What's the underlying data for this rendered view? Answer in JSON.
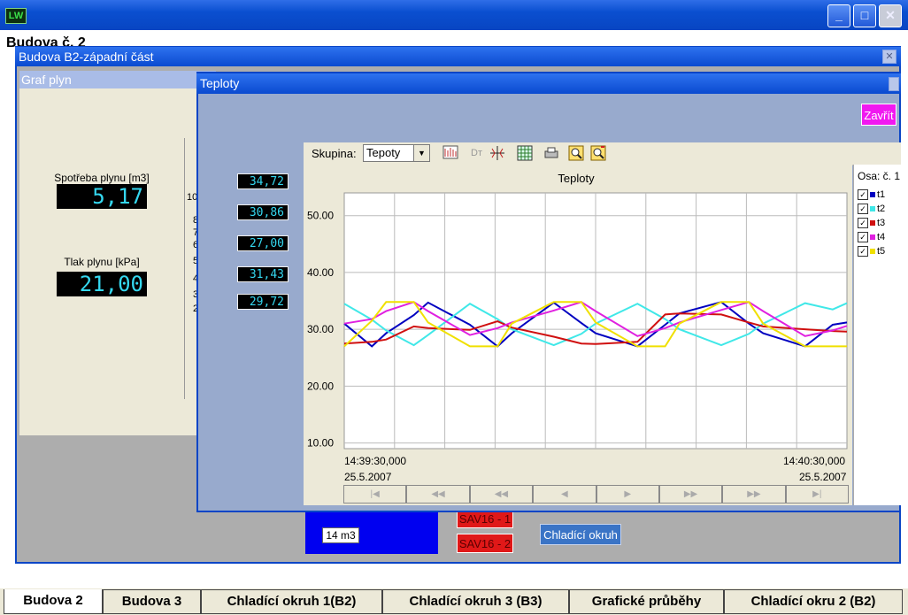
{
  "app": {
    "icon_text": "LW",
    "page_heading": "Budova č. 2",
    "window_buttons": {
      "minimize": "_",
      "maximize": "□",
      "close": "✕"
    }
  },
  "window_b2": {
    "title": "Budova B2-západní část",
    "close": "✕",
    "gas_panel": {
      "title": "Graf plyn",
      "consumption_label": "Spotřeba plynu [m3]",
      "consumption_value": "5,17",
      "pressure_label": "Tlak plynu [kPa]",
      "pressure_value": "21,00",
      "axis_peek": [
        "10",
        "8",
        "7",
        "6",
        "5",
        "4",
        "3",
        "2"
      ]
    },
    "lower": {
      "blue_label": "14 m3",
      "sav_buttons": [
        "SAV16 - 1",
        "SAV16 - 2"
      ],
      "cooling_button": "Chladící okruh"
    }
  },
  "window_teploty": {
    "title": "Teploty",
    "close_button": "Zavřít",
    "readouts": [
      "34,72",
      "30,86",
      "27,00",
      "31,43",
      "29,72"
    ],
    "toolbar": {
      "group_label": "Skupina:",
      "group_value": "Tepoty",
      "icons": [
        "chart-icon",
        "dt-icon",
        "cursor-icon",
        "grid-icon",
        "print-icon",
        "zoom-in-icon",
        "zoom-out-icon"
      ]
    },
    "legend": {
      "title": "Osa: č. 1",
      "items": [
        {
          "label": "t1",
          "color": "#0000c0"
        },
        {
          "label": "t2",
          "color": "#40e8e8"
        },
        {
          "label": "t3",
          "color": "#d01010"
        },
        {
          "label": "t4",
          "color": "#e020e0"
        },
        {
          "label": "t5",
          "color": "#f0e000"
        }
      ]
    },
    "time_axis": {
      "start_time": "14:39:30,000",
      "start_date": "25.5.2007",
      "end_time": "14:40:30,000",
      "end_date": "25.5.2007"
    },
    "nav_buttons": [
      "|◀",
      "◀◀",
      "◀◀",
      "◀",
      "▶",
      "▶▶",
      "▶▶",
      "▶|"
    ]
  },
  "chart_data": {
    "type": "line",
    "title": "Teploty",
    "xlabel": "",
    "ylabel": "",
    "ylim": [
      9,
      54
    ],
    "yticks": [
      "50.00",
      "40.00",
      "30.00",
      "20.00",
      "10.00"
    ],
    "ytick_values": [
      50,
      40,
      30,
      20,
      10
    ],
    "grid": true,
    "legend_position": "right",
    "x": [
      0,
      3.3,
      5,
      8.3,
      10,
      15,
      18.3,
      20,
      25,
      28.3,
      30,
      35,
      38.3,
      40,
      45,
      48.3,
      50,
      55,
      58.3,
      60
    ],
    "series": [
      {
        "name": "t1",
        "color": "#0000c0",
        "values": [
          31,
          27,
          29.3,
          32.5,
          34.7,
          30.8,
          27,
          29.3,
          34.7,
          31.1,
          29.3,
          27,
          30.8,
          32.8,
          34.8,
          31,
          29.3,
          27,
          30.8,
          31.2
        ]
      },
      {
        "name": "t2",
        "color": "#40e8e8",
        "values": [
          34.5,
          31.7,
          29.8,
          27.2,
          29,
          34.5,
          31.8,
          30,
          27.2,
          29.2,
          31,
          34.5,
          31.8,
          30,
          27.2,
          29.2,
          31,
          34.6,
          33.5,
          34.6
        ]
      },
      {
        "name": "t3",
        "color": "#d01010",
        "values": [
          27.5,
          27.8,
          28.2,
          30.5,
          30.2,
          29.9,
          31.4,
          30.3,
          28.7,
          27.5,
          27.4,
          27.8,
          32.6,
          32.8,
          32.6,
          31.2,
          30.5,
          30,
          29.7,
          29.6
        ]
      },
      {
        "name": "t4",
        "color": "#e020e0",
        "values": [
          31,
          31.8,
          33.2,
          34.8,
          33.2,
          29,
          30.2,
          31.2,
          33.3,
          34.8,
          33.2,
          28.8,
          30.2,
          31.2,
          33.4,
          34.8,
          33.2,
          28.8,
          29.8,
          30.6
        ]
      },
      {
        "name": "t5",
        "color": "#f0e000",
        "values": [
          27,
          31.5,
          34.8,
          34.8,
          31.2,
          27,
          27,
          31,
          34.8,
          34.8,
          31.2,
          27,
          27,
          31,
          34.8,
          34.8,
          31,
          27,
          27,
          27
        ]
      }
    ]
  },
  "tabs": [
    {
      "label": "Budova 2",
      "active": true
    },
    {
      "label": "Budova 3",
      "active": false
    },
    {
      "label": "Chladící okruh 1(B2)",
      "active": false
    },
    {
      "label": "Chladící okruh 3 (B3)",
      "active": false
    },
    {
      "label": "Grafické průběhy",
      "active": false
    },
    {
      "label": "Chladící okru 2 (B2)",
      "active": false
    }
  ]
}
